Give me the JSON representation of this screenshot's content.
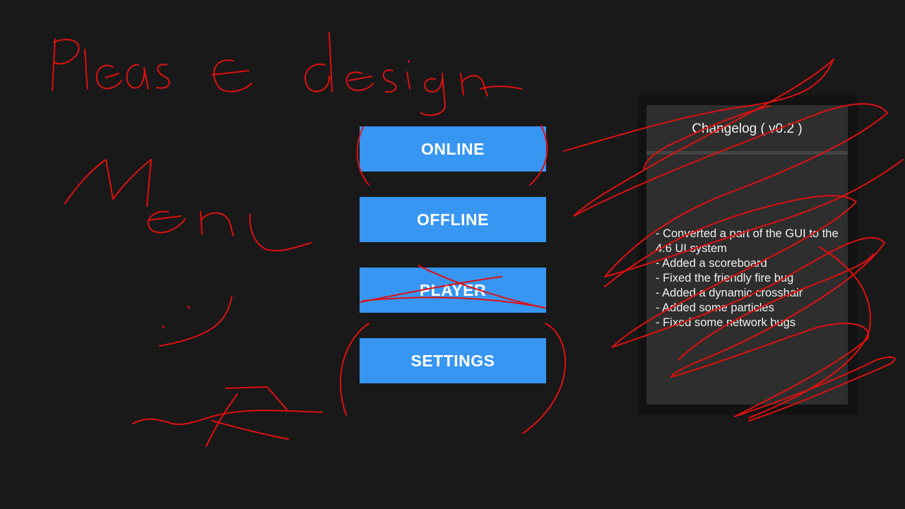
{
  "menu": {
    "buttons": [
      {
        "id": "online",
        "label": "ONLINE"
      },
      {
        "id": "offline",
        "label": "OFFLINE"
      },
      {
        "id": "player",
        "label": "PLAYER"
      },
      {
        "id": "settings",
        "label": "SETTINGS"
      }
    ]
  },
  "changelog": {
    "title": "Changelog ( v0.2 )",
    "lines": [
      "- Converted a part of the GUI to the 4.6 UI system",
      "- Added a scoreboard",
      "- Fixed the friendly fire bug",
      "- Added a dynamic crosshair",
      "- Added some particles",
      "- Fixed some network bugs"
    ]
  },
  "annotation": {
    "handwritten_text": "Please design Menu :)",
    "color": "#e01010"
  },
  "colors": {
    "background": "#191919",
    "button": "#3796f2",
    "panel": "#2e2e2e",
    "panel_frame": "#121212"
  }
}
